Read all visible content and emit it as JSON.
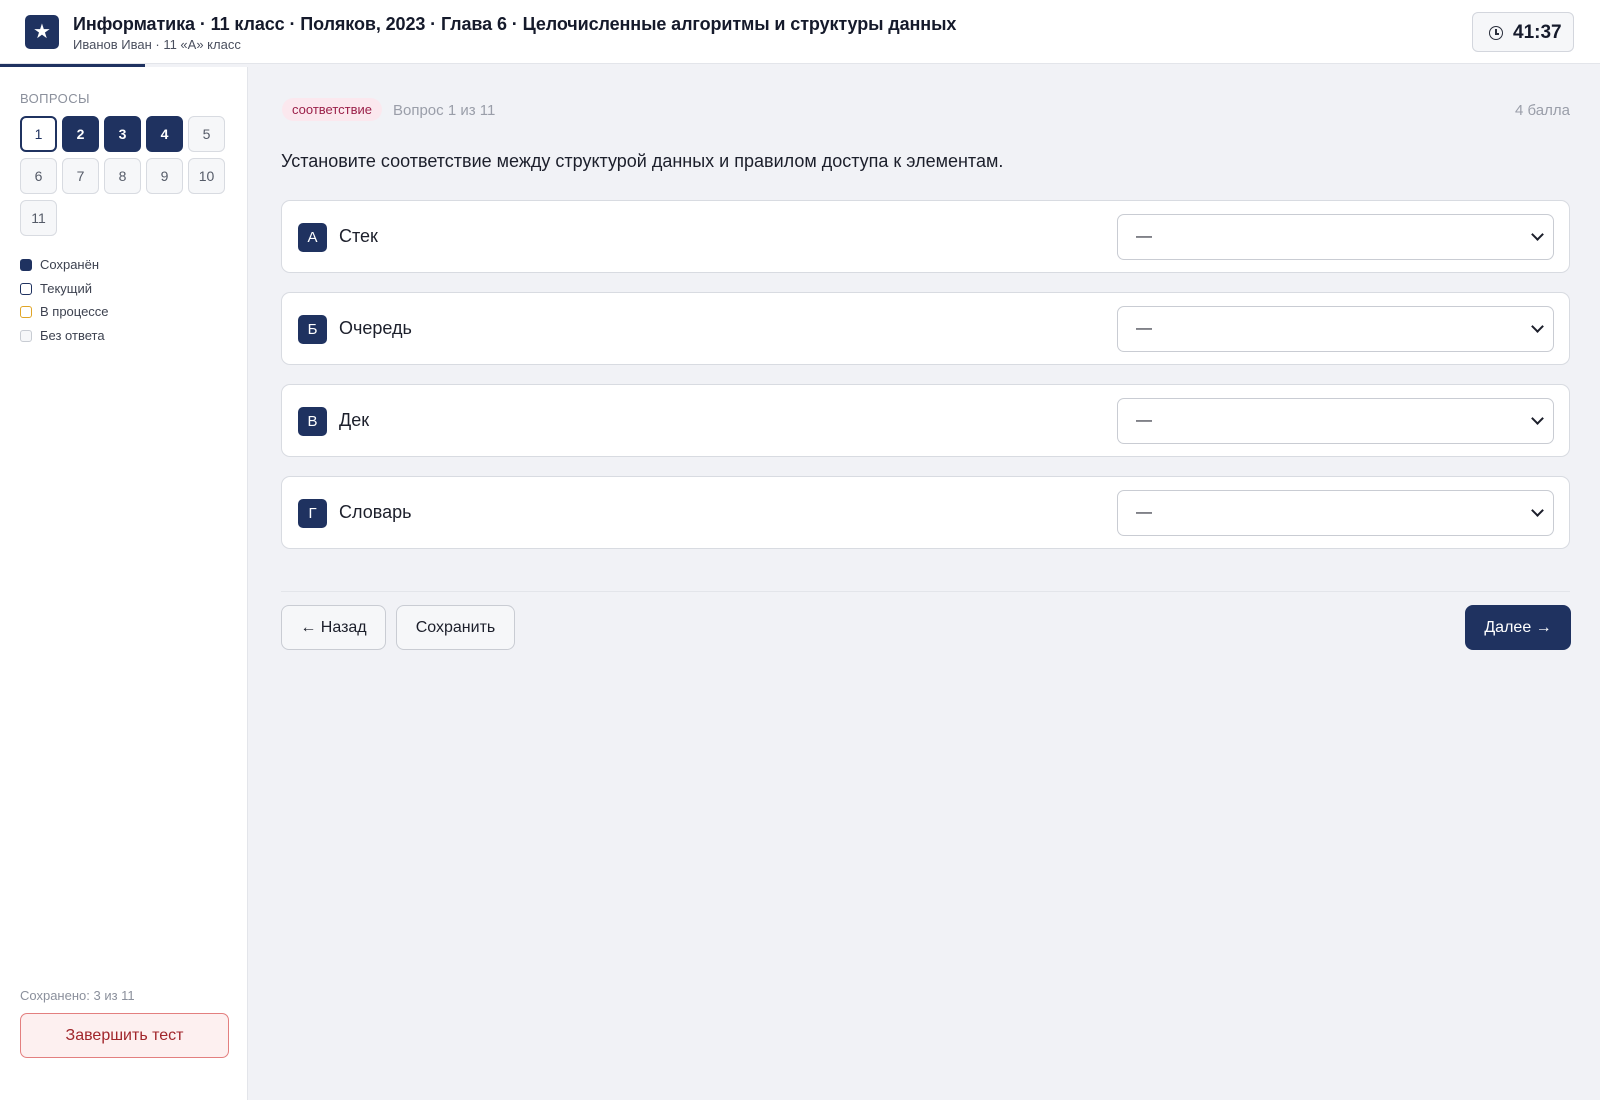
{
  "header": {
    "logo_glyph": "★",
    "title": "Информатика · 11 класс · Поляков, 2023 · Глава 6 · Целочисленные алгоритмы и структуры данных",
    "subtitle": "Иванов Иван · 11 «А» класс",
    "timer": "41:37",
    "progress_fraction": 0.0909
  },
  "sidebar": {
    "heading": "ВОПРОСЫ",
    "questions": [
      {
        "label": "1",
        "state": "current"
      },
      {
        "label": "2",
        "state": "saved"
      },
      {
        "label": "3",
        "state": "saved"
      },
      {
        "label": "4",
        "state": "saved"
      },
      {
        "label": "5",
        "state": "empty"
      },
      {
        "label": "6",
        "state": "empty"
      },
      {
        "label": "7",
        "state": "empty"
      },
      {
        "label": "8",
        "state": "empty"
      },
      {
        "label": "9",
        "state": "empty"
      },
      {
        "label": "10",
        "state": "empty"
      },
      {
        "label": "11",
        "state": "empty"
      }
    ],
    "legend": [
      {
        "label": "Сохранён",
        "kind": "saved"
      },
      {
        "label": "Текущий",
        "kind": "current"
      },
      {
        "label": "В процессе",
        "kind": "progress"
      },
      {
        "label": "Без ответа",
        "kind": "empty"
      }
    ],
    "saved_count": "Сохранено: 3 из 11",
    "finish_label": "Завершить тест"
  },
  "question": {
    "tag": "соответствие",
    "number": "Вопрос 1 из 11",
    "points": "4 балла",
    "prompt": "Установите соответствие между структурой данных и правилом доступа к элементам.",
    "rows": [
      {
        "letter": "А",
        "label": "Стек",
        "selected": "—"
      },
      {
        "letter": "Б",
        "label": "Очередь",
        "selected": "—"
      },
      {
        "letter": "В",
        "label": "Дек",
        "selected": "—"
      },
      {
        "letter": "Г",
        "label": "Словарь",
        "selected": "—"
      }
    ]
  },
  "actions": {
    "back": "← Назад",
    "save": "Сохранить",
    "next": "Далее →"
  },
  "colors": {
    "primary": "#1f3260",
    "tag_bg": "#fbe8ee",
    "tag_text": "#9b2049",
    "finish_border": "#e37f7f",
    "in_progress": "#e0a526"
  }
}
